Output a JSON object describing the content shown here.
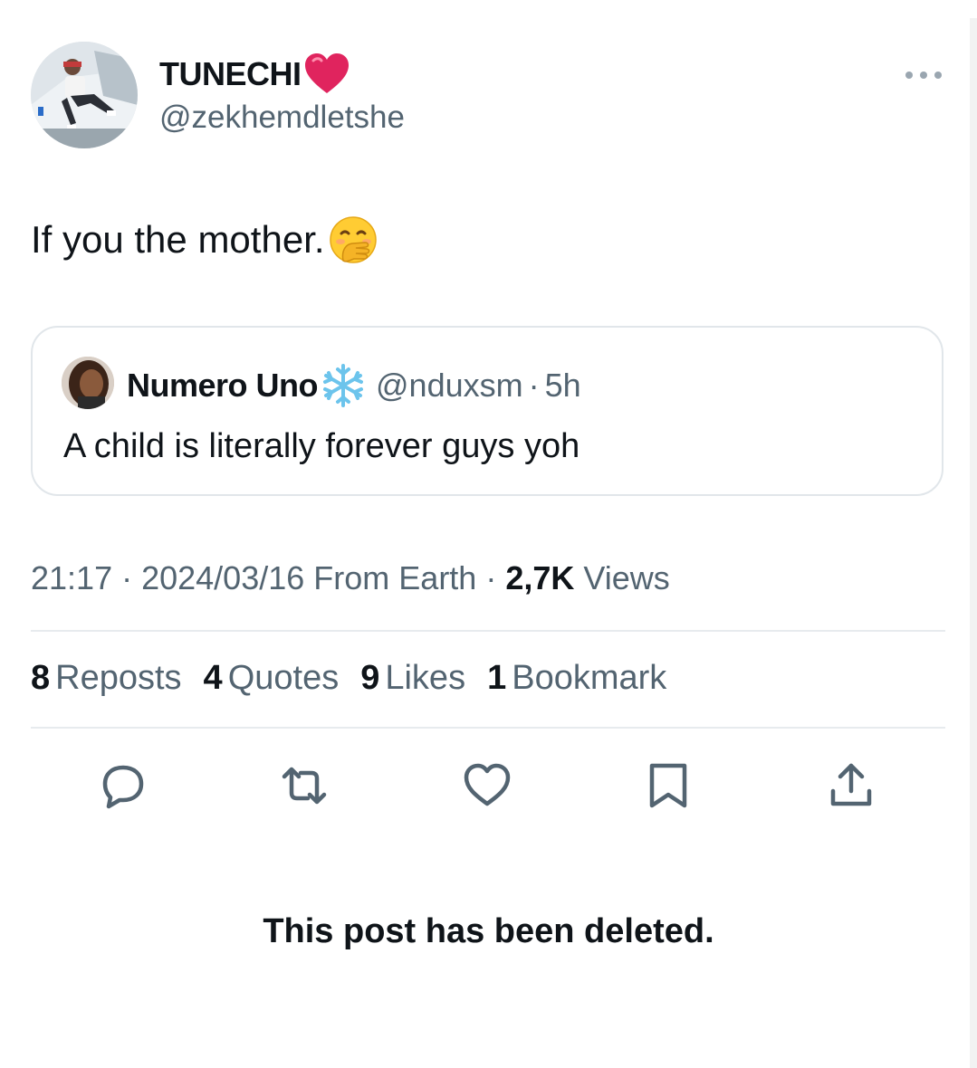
{
  "author": {
    "display_name": "TUNECHI",
    "handle": "@zekhemdletshe"
  },
  "tweet": {
    "text": "If you the mother."
  },
  "quoted_tweet": {
    "display_name": "Numero Uno",
    "handle": "@nduxsm",
    "separator": "·",
    "time": "5h",
    "text": "A child is literally forever guys yoh"
  },
  "meta": {
    "time": "21:17",
    "sep1": " · ",
    "date": "2024/03/16",
    "source": "From Earth",
    "sep2": " · ",
    "views_count": "2,7K",
    "views_label": "Views"
  },
  "stats": [
    {
      "count": "8",
      "label": "Reposts"
    },
    {
      "count": "4",
      "label": "Quotes"
    },
    {
      "count": "9",
      "label": "Likes"
    },
    {
      "count": "1",
      "label": "Bookmark"
    }
  ],
  "actions": {
    "icons": [
      "reply-icon",
      "repost-icon",
      "like-icon",
      "bookmark-icon",
      "share-icon"
    ]
  },
  "notice": "This post has been deleted.",
  "colors": {
    "text_primary": "#0f1419",
    "text_secondary": "#536471",
    "border": "#e1e6ea",
    "heart_red": "#e0245e"
  }
}
